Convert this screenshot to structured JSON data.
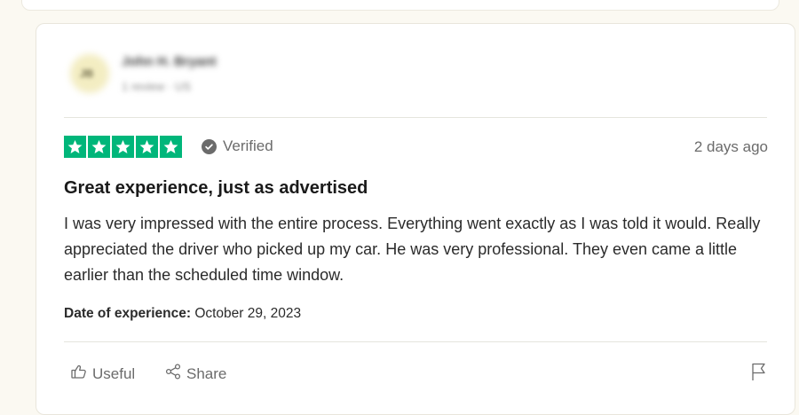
{
  "consumer": {
    "initials": "JB",
    "name": "John H. Bryant",
    "meta": "1 review · US"
  },
  "rating": {
    "stars": 5,
    "max_stars": 5,
    "color": "#00b67a"
  },
  "verified_label": "Verified",
  "review_date": "2 days ago",
  "review": {
    "title": "Great experience, just as advertised",
    "body": "I was very impressed with the entire process. Everything went exactly as I was told it would. Really appreciated the driver who picked up my car. He was very professional. They even came a little earlier than the scheduled time window."
  },
  "experience": {
    "label": "Date of experience:",
    "value": "October 29, 2023"
  },
  "actions": {
    "useful_label": "Useful",
    "share_label": "Share",
    "useful_icon": "thumbs-up-icon",
    "share_icon": "share-icon",
    "report_icon": "flag-icon"
  }
}
